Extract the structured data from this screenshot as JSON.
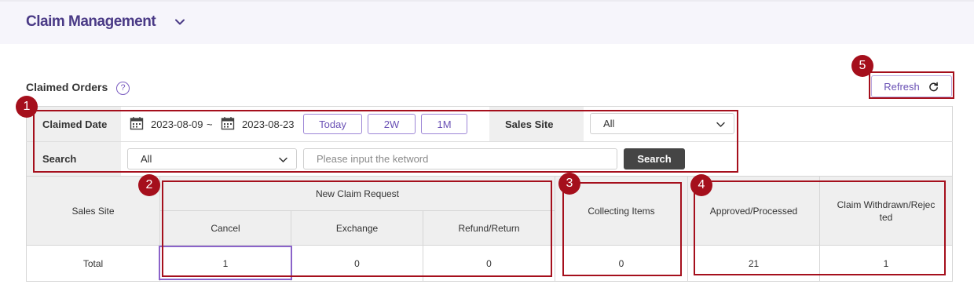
{
  "header": {
    "title": "Claim Management",
    "dropdown_icon": "chevron-down-icon"
  },
  "section": {
    "title": "Claimed Orders",
    "help_icon": "?"
  },
  "toolbar": {
    "refresh_label": "Refresh",
    "refresh_icon": "refresh-icon"
  },
  "filters": {
    "claimed_date_label": "Claimed Date",
    "date_from": "2023-08-09",
    "date_separator": "~",
    "date_to": "2023-08-23",
    "period_buttons": [
      "Today",
      "2W",
      "1M"
    ],
    "sales_site_label": "Sales Site",
    "sales_site_value": "All",
    "search_label": "Search",
    "search_type_value": "All",
    "keyword_placeholder": "Please input the ketword",
    "search_button": "Search"
  },
  "table": {
    "sales_site_header": "Sales Site",
    "new_claim_header": "New Claim Request",
    "sub_headers": [
      "Cancel",
      "Exchange",
      "Refund/Return"
    ],
    "collecting_header": "Collecting Items",
    "approved_header": "Approved/Processed",
    "withdrawn_header": "Claim Withdrawn/Rejected",
    "total_row": {
      "label": "Total",
      "cancel": "1",
      "exchange": "0",
      "refund_return": "0",
      "collecting": "0",
      "approved": "21",
      "withdrawn": "1"
    }
  },
  "annotations": [
    "1",
    "2",
    "3",
    "4",
    "5"
  ],
  "colors": {
    "accent": "#6a51b5",
    "title": "#4a3a86",
    "annotation": "#a50f1c",
    "header_bg": "#f6f5fb"
  }
}
